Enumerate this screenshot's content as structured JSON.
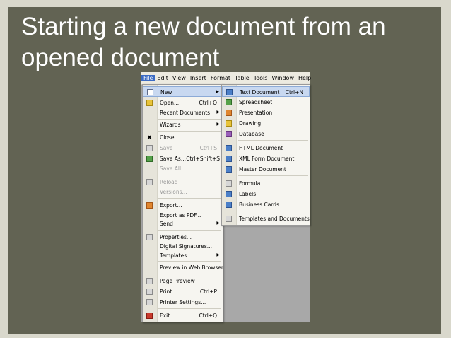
{
  "title": "Starting a new document from an opened document",
  "menubar": [
    "File",
    "Edit",
    "View",
    "Insert",
    "Format",
    "Table",
    "Tools",
    "Window",
    "Help"
  ],
  "file_menu": [
    {
      "label": "New",
      "shortcut": "",
      "submenu": true,
      "icon": "new-doc-icon"
    },
    {
      "label": "Open...",
      "shortcut": "Ctrl+O",
      "icon": "open-folder-icon"
    },
    {
      "label": "Recent Documents",
      "shortcut": "",
      "submenu": true,
      "icon": ""
    },
    {
      "label": "Wizards",
      "shortcut": "",
      "submenu": true,
      "icon": ""
    },
    {
      "label": "Close",
      "shortcut": "",
      "icon": "close-x-icon"
    },
    {
      "label": "Save",
      "shortcut": "Ctrl+S",
      "disabled": true,
      "icon": "save-icon"
    },
    {
      "label": "Save As...",
      "shortcut": "Ctrl+Shift+S",
      "icon": "save-as-icon"
    },
    {
      "label": "Save All",
      "shortcut": "",
      "disabled": true,
      "icon": ""
    },
    {
      "label": "Reload",
      "shortcut": "",
      "disabled": true,
      "icon": "reload-icon"
    },
    {
      "label": "Versions...",
      "shortcut": "",
      "disabled": true,
      "icon": ""
    },
    {
      "label": "Export...",
      "shortcut": "",
      "icon": "export-icon"
    },
    {
      "label": "Export as PDF...",
      "shortcut": "",
      "icon": ""
    },
    {
      "label": "Send",
      "shortcut": "",
      "submenu": true,
      "icon": ""
    },
    {
      "label": "Properties...",
      "shortcut": "",
      "icon": "properties-icon"
    },
    {
      "label": "Digital Signatures...",
      "shortcut": "",
      "icon": ""
    },
    {
      "label": "Templates",
      "shortcut": "",
      "submenu": true,
      "icon": ""
    },
    {
      "label": "Preview in Web Browser",
      "shortcut": "",
      "icon": ""
    },
    {
      "label": "Page Preview",
      "shortcut": "",
      "icon": "page-preview-icon"
    },
    {
      "label": "Print...",
      "shortcut": "Ctrl+P",
      "icon": "print-icon"
    },
    {
      "label": "Printer Settings...",
      "shortcut": "",
      "icon": "printer-settings-icon"
    },
    {
      "label": "Exit",
      "shortcut": "Ctrl+Q",
      "icon": "exit-icon"
    }
  ],
  "new_menu": [
    {
      "label": "Text Document",
      "shortcut": "Ctrl+N",
      "icon": "text-document-icon"
    },
    {
      "label": "Spreadsheet",
      "shortcut": "",
      "icon": "spreadsheet-icon"
    },
    {
      "label": "Presentation",
      "shortcut": "",
      "icon": "presentation-icon"
    },
    {
      "label": "Drawing",
      "shortcut": "",
      "icon": "drawing-icon"
    },
    {
      "label": "Database",
      "shortcut": "",
      "icon": "database-icon"
    },
    {
      "label": "HTML Document",
      "shortcut": "",
      "icon": "html-document-icon"
    },
    {
      "label": "XML Form Document",
      "shortcut": "",
      "icon": "xml-form-icon"
    },
    {
      "label": "Master Document",
      "shortcut": "",
      "icon": "master-document-icon"
    },
    {
      "label": "Formula",
      "shortcut": "",
      "icon": "formula-icon"
    },
    {
      "label": "Labels",
      "shortcut": "",
      "icon": "labels-icon"
    },
    {
      "label": "Business Cards",
      "shortcut": "",
      "icon": "business-cards-icon"
    },
    {
      "label": "Templates and Documents",
      "shortcut": "",
      "icon": "templates-icon"
    }
  ]
}
